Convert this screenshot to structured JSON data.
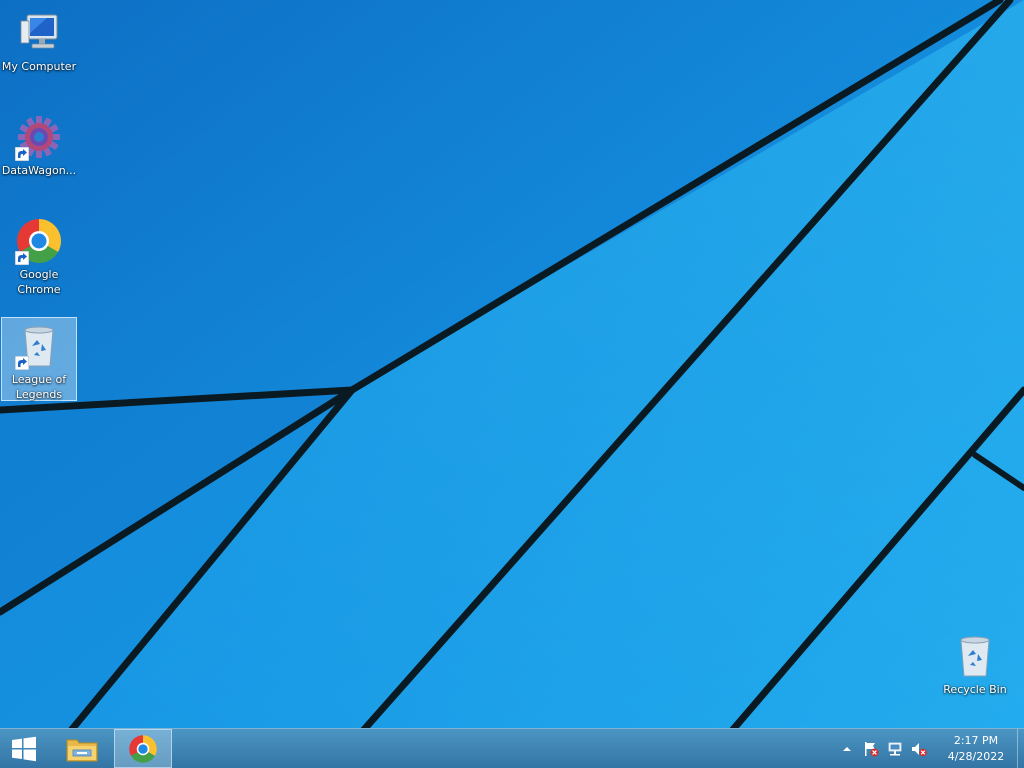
{
  "desktop": {
    "icons": [
      {
        "label": "My Computer",
        "icon": "computer-icon"
      },
      {
        "label": "DataWagon...",
        "icon": "datawagon-gear-icon"
      },
      {
        "label": "Google Chrome",
        "icon": "chrome-icon"
      },
      {
        "label": "League of Legends",
        "icon": "recycle-bin-icon",
        "selected": true
      },
      {
        "label": "Recycle Bin",
        "icon": "recycle-bin-icon"
      }
    ]
  },
  "taskbar": {
    "start_icon": "windows-logo-icon",
    "pinned": [
      {
        "name": "File Explorer",
        "icon": "folder-icon"
      },
      {
        "name": "Google Chrome",
        "icon": "chrome-icon",
        "active": true
      }
    ],
    "tray": {
      "icons": [
        "chevron-up-icon",
        "action-center-flag-icon",
        "network-icon",
        "volume-muted-icon"
      ],
      "time": "2:17 PM",
      "date": "4/28/2022"
    }
  },
  "colors": {
    "wallpaper_blue": "#1690e0",
    "wallpaper_light": "#29b8f2",
    "wallpaper_line": "#0a1a22",
    "taskbar": "#2d7bb0"
  }
}
